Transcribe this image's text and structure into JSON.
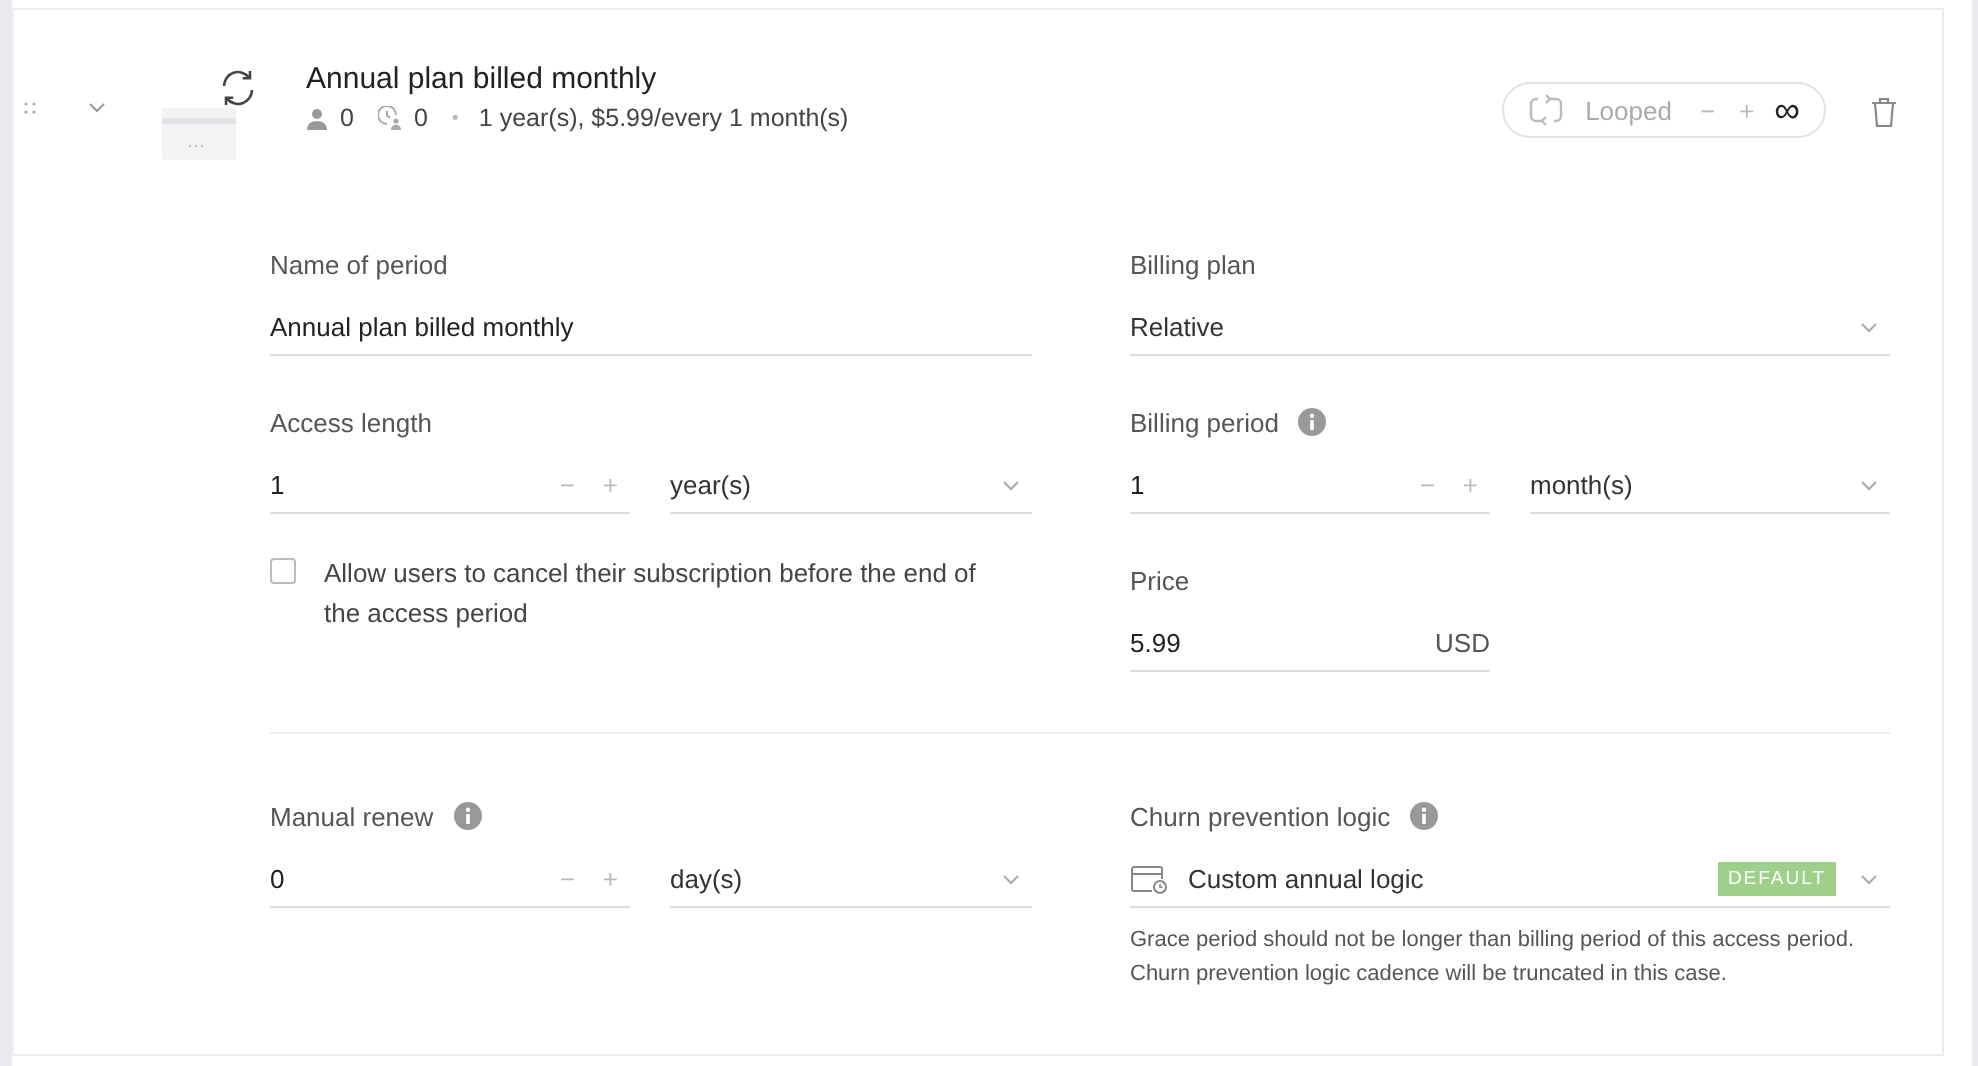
{
  "period": {
    "title": "Annual plan billed monthly",
    "expanded": true,
    "stats": [
      {
        "kind": "users",
        "value": "0"
      },
      {
        "kind": "pending",
        "value": "0"
      }
    ],
    "separator": "•",
    "summary": "1 year(s), $5.99/every 1 month(s)"
  },
  "loop": {
    "label": "Looped",
    "minus": "−",
    "plus": "+",
    "symbol": "∞"
  },
  "name_of_period": {
    "label": "Name of period",
    "value": "Annual plan billed monthly"
  },
  "billing_plan": {
    "label": "Billing plan",
    "value": "Relative"
  },
  "access_length": {
    "label": "Access length",
    "value": "1",
    "minus": "−",
    "plus": "+",
    "unit": "year(s)"
  },
  "billing_period": {
    "label": "Billing period",
    "value": "1",
    "minus": "−",
    "plus": "+",
    "unit": "month(s)"
  },
  "cancel_option": {
    "label": "Allow users to cancel their subscription before the end of the access period",
    "checked": false
  },
  "price": {
    "label": "Price",
    "value": "5.99",
    "currency": "USD"
  },
  "manual_renew": {
    "label": "Manual renew",
    "value": "0",
    "minus": "−",
    "plus": "+",
    "unit": "day(s)"
  },
  "churn_prevention": {
    "label": "Churn prevention logic",
    "value": "Custom annual logic",
    "badge": "DEFAULT",
    "note": "Grace period should not be longer than billing period of this access period. Churn prevention logic cadence will be truncated in this case."
  }
}
